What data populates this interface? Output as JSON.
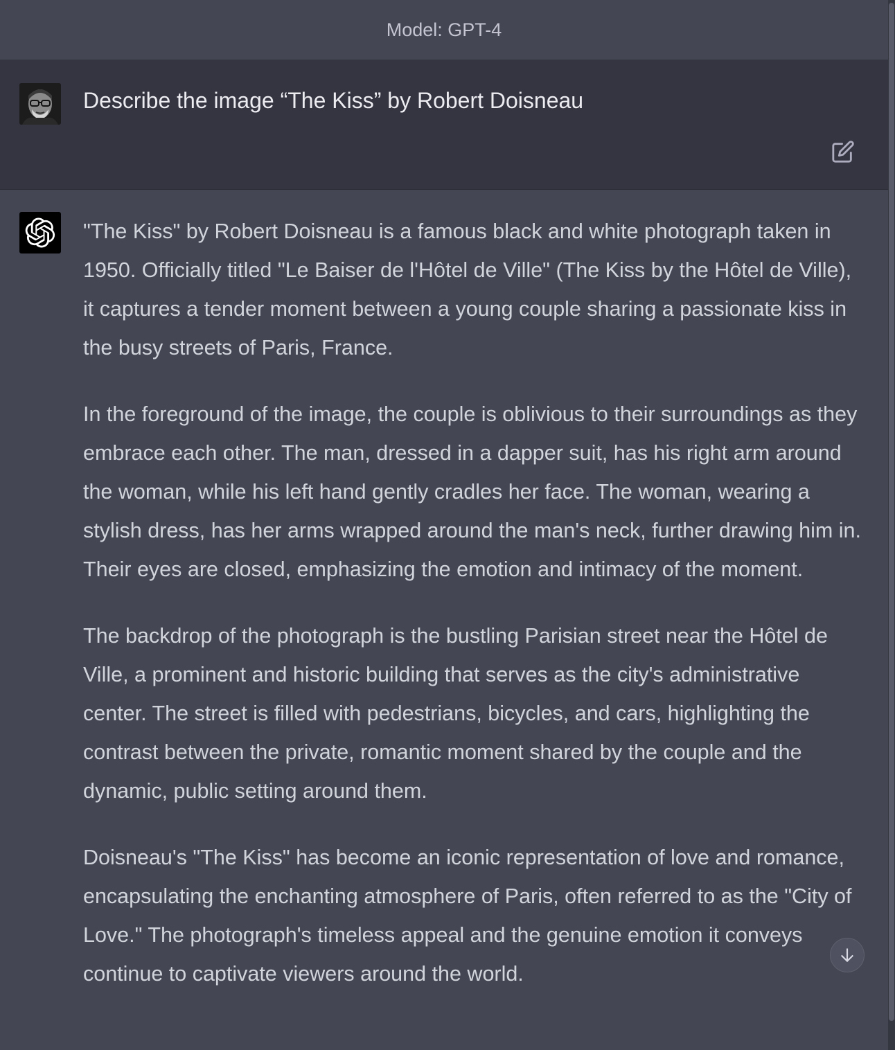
{
  "header": {
    "model_label": "Model: GPT-4"
  },
  "user_message": {
    "avatar_icon": "user-photo-avatar",
    "text": "Describe the image “The Kiss” by Robert Doisneau",
    "edit_icon": "edit-icon"
  },
  "assistant_message": {
    "avatar_icon": "openai-logo-icon",
    "avatar_bg": "#000000",
    "paragraphs": [
      "\"The Kiss\" by Robert Doisneau is a famous black and white photograph taken in 1950. Officially titled \"Le Baiser de l'Hôtel de Ville\" (The Kiss by the Hôtel de Ville), it captures a tender moment between a young couple sharing a passionate kiss in the busy streets of Paris, France.",
      "In the foreground of the image, the couple is oblivious to their surroundings as they embrace each other. The man, dressed in a dapper suit, has his right arm around the woman, while his left hand gently cradles her face. The woman, wearing a stylish dress, has her arms wrapped around the man's neck, further drawing him in. Their eyes are closed, emphasizing the emotion and intimacy of the moment.",
      "The backdrop of the photograph is the bustling Parisian street near the Hôtel de Ville, a prominent and historic building that serves as the city's administrative center. The street is filled with pedestrians, bicycles, and cars, highlighting the contrast between the private, romantic moment shared by the couple and the dynamic, public setting around them.",
      "Doisneau's \"The Kiss\" has become an iconic representation of love and romance, encapsulating the enchanting atmosphere of Paris, often referred to as the \"City of Love.\" The photograph's timeless appeal and the genuine emotion it conveys continue to captivate viewers around the world."
    ]
  },
  "controls": {
    "scroll_down_icon": "arrow-down-icon"
  },
  "colors": {
    "assistant_bg": "#444654",
    "user_bg": "#343541",
    "text": "#d1d5db"
  }
}
